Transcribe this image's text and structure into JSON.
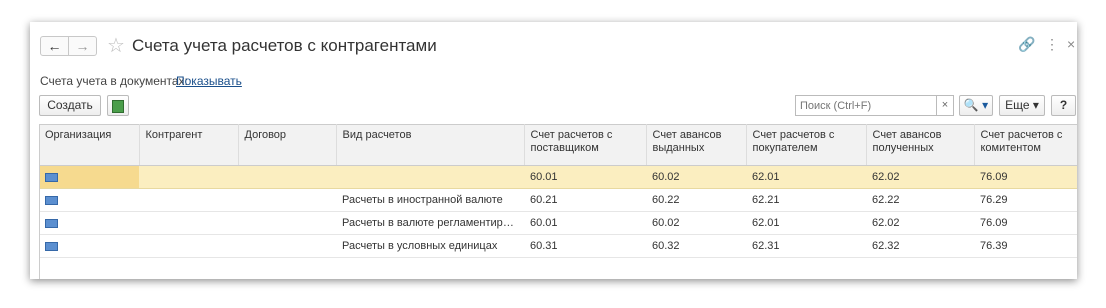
{
  "window": {
    "title": "Счета учета расчетов с контрагентами",
    "back_icon": "←",
    "forward_icon": "→",
    "star_icon": "☆",
    "link_icon": "🔗",
    "menu_icon": "⋮",
    "close_icon": "×"
  },
  "docs": {
    "label": "Счета учета в документах:",
    "link": "Показывать"
  },
  "toolbar": {
    "create_label": "Создать",
    "search_placeholder": "Поиск (Ctrl+F)",
    "search_clear": "×",
    "search_button": "🔍 ▾",
    "more_label": "Еще ▾",
    "help_label": "?"
  },
  "table": {
    "columns": [
      "Организация",
      "Контрагент",
      "Договор",
      "Вид расчетов",
      "Счет расчетов с поставщиком",
      "Счет авансов выданных",
      "Счет расчетов с покупателем",
      "Счет авансов полученных",
      "Счет расчетов с комитентом"
    ],
    "rows": [
      [
        "",
        "",
        "",
        "",
        "60.01",
        "60.02",
        "62.01",
        "62.02",
        "76.09"
      ],
      [
        "",
        "",
        "",
        "Расчеты в иностранной валюте",
        "60.21",
        "60.22",
        "62.21",
        "62.22",
        "76.29"
      ],
      [
        "",
        "",
        "",
        "Расчеты в валюте регламентиро...",
        "60.01",
        "60.02",
        "62.01",
        "62.02",
        "76.09"
      ],
      [
        "",
        "",
        "",
        "Расчеты в условных единицах",
        "60.31",
        "60.32",
        "62.31",
        "62.32",
        "76.39"
      ]
    ]
  },
  "colors": {
    "selected_row": "#fbeec0",
    "link": "#1a4f8b"
  }
}
